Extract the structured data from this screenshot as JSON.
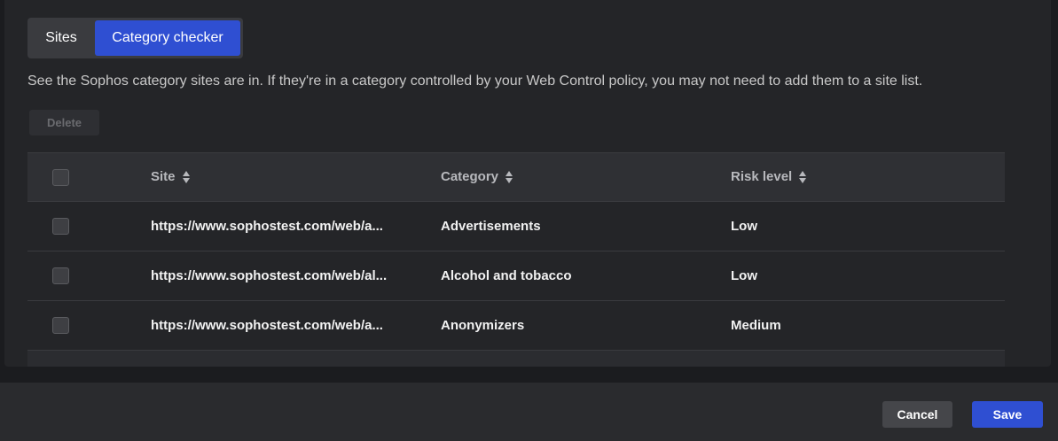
{
  "tabs": {
    "sites": "Sites",
    "category_checker": "Category checker"
  },
  "description": "See the Sophos category sites are in. If they're in a category controlled by your Web Control policy, you may not need to add them to a site list.",
  "toolbar": {
    "delete_label": "Delete"
  },
  "table": {
    "headers": {
      "site": "Site",
      "category": "Category",
      "risk": "Risk level"
    },
    "rows": [
      {
        "site": "https://www.sophostest.com/web/a...",
        "category": "Advertisements",
        "risk": "Low"
      },
      {
        "site": "https://www.sophostest.com/web/al...",
        "category": "Alcohol and tobacco",
        "risk": "Low"
      },
      {
        "site": "https://www.sophostest.com/web/a...",
        "category": "Anonymizers",
        "risk": "Medium"
      }
    ]
  },
  "footer": {
    "cancel_label": "Cancel",
    "save_label": "Save"
  },
  "colors": {
    "accent": "#2f4fd2",
    "panel": "#242528",
    "background": "#1b1c1f"
  }
}
